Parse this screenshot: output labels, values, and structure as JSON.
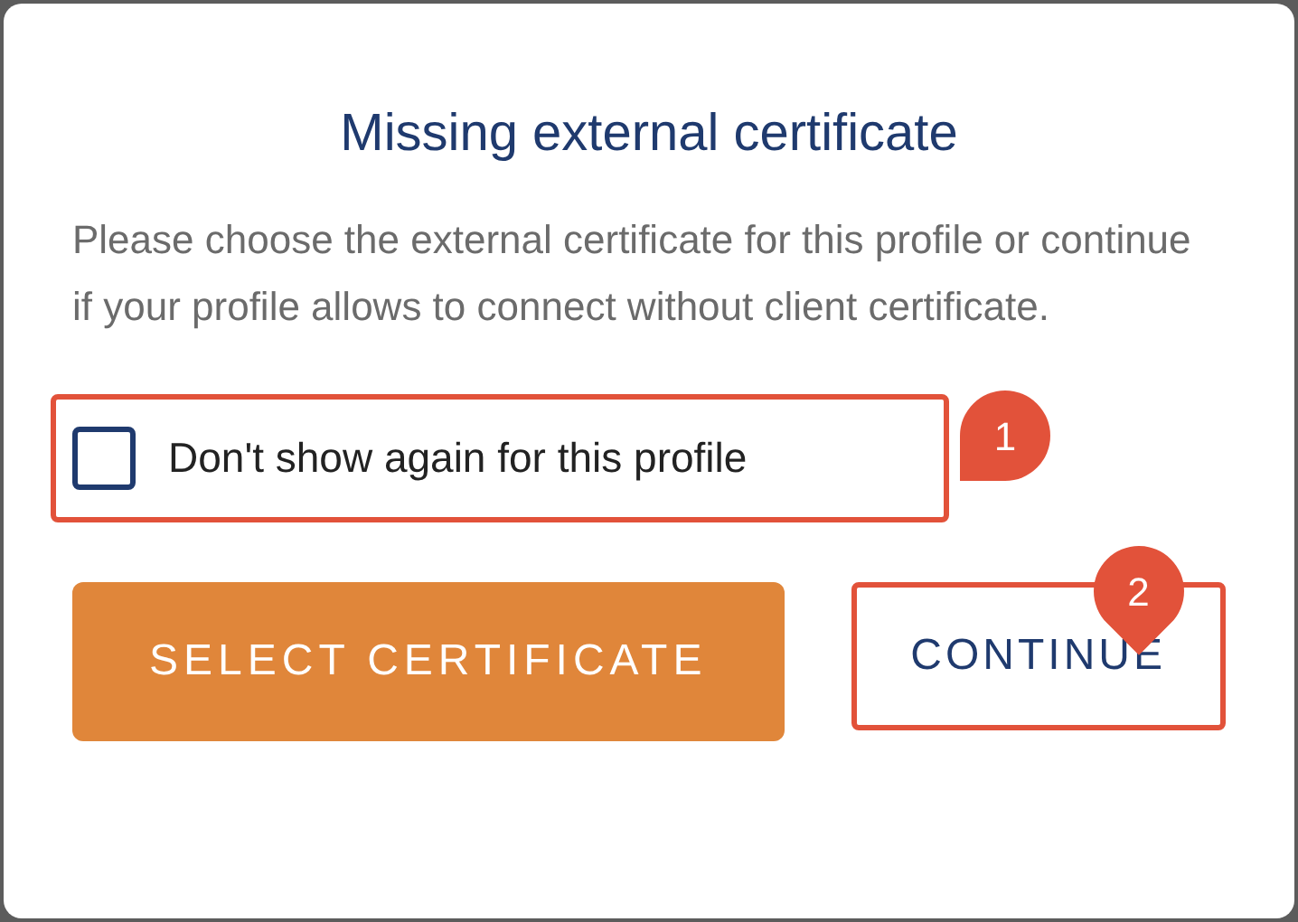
{
  "dialog": {
    "title": "Missing external certificate",
    "message": "Please choose the external certificate for this profile or continue if your profile allows to connect without client certificate.",
    "checkbox": {
      "label": "Don't show again for this profile",
      "checked": false
    },
    "buttons": [
      {
        "label": "SELECT CERTIFICATE",
        "kind": "primary"
      },
      {
        "label": "CONTINUE",
        "kind": "text"
      }
    ]
  },
  "annotations": [
    {
      "label": "1"
    },
    {
      "label": "2"
    }
  ]
}
